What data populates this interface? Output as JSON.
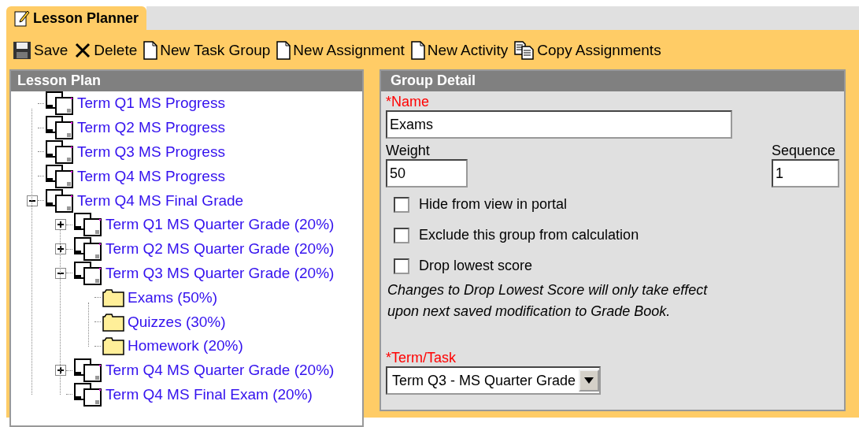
{
  "tab": {
    "label": "Lesson Planner",
    "selected": true
  },
  "toolbar": [
    {
      "kind": "save",
      "label": "Save"
    },
    {
      "kind": "delete",
      "label": "Delete"
    },
    {
      "kind": "new",
      "label": "New Task Group"
    },
    {
      "kind": "new",
      "label": "New Assignment"
    },
    {
      "kind": "new",
      "label": "New Activity"
    },
    {
      "kind": "copy",
      "label": "Copy Assignments"
    }
  ],
  "lesson_plan": {
    "title": "Lesson Plan",
    "items": [
      {
        "kind": "group",
        "label": "Term Q1 MS Progress"
      },
      {
        "kind": "group",
        "label": "Term Q2 MS Progress"
      },
      {
        "kind": "group",
        "label": "Term Q3 MS Progress"
      },
      {
        "kind": "group",
        "label": "Term Q4 MS Progress"
      },
      {
        "kind": "group",
        "label": "Term Q4 MS Final Grade",
        "expanded": true,
        "children": [
          {
            "kind": "group",
            "label": "Term Q1 MS Quarter Grade (20%)",
            "expanded": false
          },
          {
            "kind": "group",
            "label": "Term Q2 MS Quarter Grade (20%)",
            "expanded": false
          },
          {
            "kind": "group",
            "label": "Term Q3 MS Quarter Grade (20%)",
            "expanded": true,
            "children": [
              {
                "kind": "folder",
                "label": "Exams (50%)"
              },
              {
                "kind": "folder",
                "label": "Quizzes (30%)"
              },
              {
                "kind": "folder",
                "label": "Homework (20%)"
              }
            ]
          },
          {
            "kind": "group",
            "label": "Term Q4 MS Quarter Grade (20%)",
            "expanded": false
          },
          {
            "kind": "group",
            "label": "Term Q4 MS Final Exam (20%)"
          }
        ]
      }
    ]
  },
  "group_detail": {
    "title": "Group Detail",
    "name": {
      "label": "*Name",
      "required": true,
      "value": "Exams"
    },
    "weight": {
      "label": "Weight",
      "required": false,
      "value": "50"
    },
    "sequence": {
      "label": "Sequence",
      "required": false,
      "value": "1"
    },
    "options": [
      {
        "label": "Hide from view in portal",
        "checked": false
      },
      {
        "label": "Exclude this group from calculation",
        "checked": false
      },
      {
        "label": "Drop lowest score",
        "checked": false
      }
    ],
    "note": "Changes to Drop Lowest Score will only take effect upon next saved modification to Grade Book.",
    "term_task": {
      "label": "*Term/Task",
      "required": true,
      "value": "Term Q3 - MS Quarter Grade"
    }
  }
}
